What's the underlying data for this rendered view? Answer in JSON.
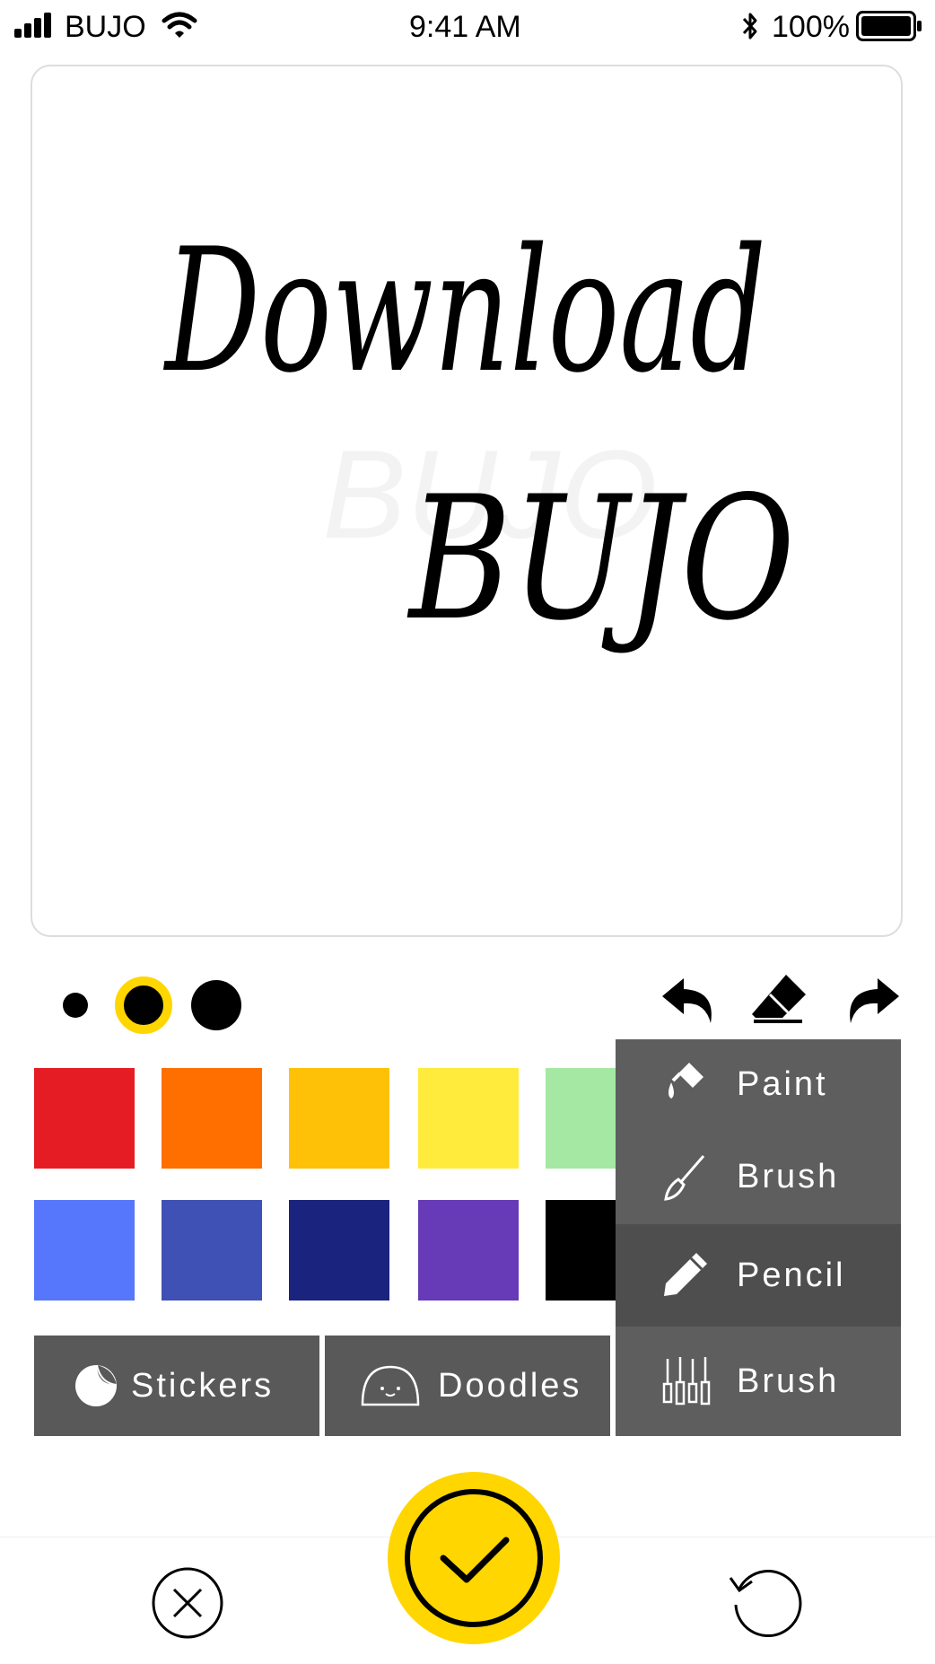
{
  "status_bar": {
    "carrier": "BUJO",
    "time": "9:41 AM",
    "battery": "100%"
  },
  "canvas": {
    "line1": "Download",
    "line2": "BUJO",
    "watermark": "BUJO"
  },
  "brush_sizes": [
    {
      "name": "small",
      "selected": false
    },
    {
      "name": "medium",
      "selected": true
    },
    {
      "name": "large",
      "selected": false
    }
  ],
  "toolbar": {
    "undo_icon": "undo-icon",
    "eraser_icon": "eraser-icon",
    "redo_icon": "redo-icon"
  },
  "colors": {
    "accent": "#FFD600",
    "panel": "#595959",
    "menu": "#5E5E5E",
    "menu_selected": "#4E4E4E",
    "row1": [
      "#E51C23",
      "#FF6F00",
      "#FFC107",
      "#FFEB3B",
      "#A5E8A3"
    ],
    "row2": [
      "#5677FC",
      "#3F51B5",
      "#1A237E",
      "#673AB7",
      "#000000"
    ]
  },
  "panel_buttons": {
    "stickers_label": "Stickers",
    "doodles_label": "Doodles"
  },
  "tool_menu": {
    "items": [
      {
        "label": "Paint",
        "icon": "paint-icon",
        "selected": false
      },
      {
        "label": "Brush",
        "icon": "brush-icon",
        "selected": false
      },
      {
        "label": "Pencil",
        "icon": "pencil-icon",
        "selected": true
      },
      {
        "label": "Brush",
        "icon": "brushes-icon",
        "selected": false
      }
    ]
  },
  "actions": {
    "cancel_icon": "close-circle-icon",
    "confirm_icon": "check-icon",
    "reset_icon": "rotate-icon"
  }
}
